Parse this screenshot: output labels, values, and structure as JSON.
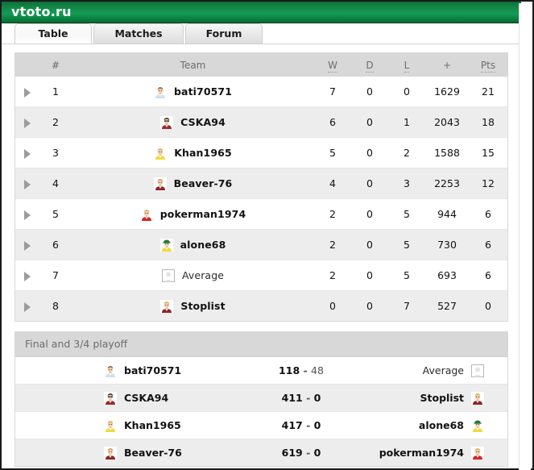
{
  "window": {
    "title": "vtoto.ru"
  },
  "tabs": [
    {
      "label": "Table",
      "active": true
    },
    {
      "label": "Matches",
      "active": false
    },
    {
      "label": "Forum",
      "active": false
    }
  ],
  "standings": {
    "columns": {
      "rank": "#",
      "team": "Team",
      "w": "W",
      "d": "D",
      "l": "L",
      "plus": "+",
      "pts": "Pts"
    },
    "rows": [
      {
        "rank": "1",
        "team": "bati70571",
        "avatar": "avatar-bati",
        "bold": true,
        "w": "7",
        "d": "0",
        "l": "0",
        "plus": "1629",
        "pts": "21"
      },
      {
        "rank": "2",
        "team": "CSKA94",
        "avatar": "avatar-cska",
        "bold": true,
        "w": "6",
        "d": "0",
        "l": "1",
        "plus": "2043",
        "pts": "18"
      },
      {
        "rank": "3",
        "team": "Khan1965",
        "avatar": "avatar-khan",
        "bold": true,
        "w": "5",
        "d": "0",
        "l": "2",
        "plus": "1588",
        "pts": "15"
      },
      {
        "rank": "4",
        "team": "Beaver-76",
        "avatar": "avatar-beaver",
        "bold": true,
        "w": "4",
        "d": "0",
        "l": "3",
        "plus": "2253",
        "pts": "12"
      },
      {
        "rank": "5",
        "team": "pokerman1974",
        "avatar": "avatar-pokerman",
        "bold": true,
        "w": "2",
        "d": "0",
        "l": "5",
        "plus": "944",
        "pts": "6"
      },
      {
        "rank": "6",
        "team": "alone68",
        "avatar": "avatar-alone",
        "bold": true,
        "w": "2",
        "d": "0",
        "l": "5",
        "plus": "730",
        "pts": "6"
      },
      {
        "rank": "7",
        "team": "Average",
        "avatar": "avatar-blank",
        "bold": false,
        "w": "2",
        "d": "0",
        "l": "5",
        "plus": "693",
        "pts": "6"
      },
      {
        "rank": "8",
        "team": "Stoplist",
        "avatar": "avatar-stoplist",
        "bold": true,
        "w": "0",
        "d": "0",
        "l": "7",
        "plus": "527",
        "pts": "0"
      }
    ]
  },
  "playoff": {
    "title": "Final and 3/4 playoff",
    "rows": [
      {
        "home": "bati70571",
        "home_avatar": "avatar-bati",
        "home_bold": true,
        "home_score": "118",
        "separator": "-",
        "away_score": "48",
        "away_score_dim": true,
        "away": "Average",
        "away_avatar": "avatar-blank",
        "away_bold": false
      },
      {
        "home": "CSKA94",
        "home_avatar": "avatar-cska",
        "home_bold": true,
        "home_score": "411",
        "separator": "-",
        "away_score": "0",
        "away_score_dim": false,
        "away": "Stoplist",
        "away_avatar": "avatar-stoplist",
        "away_bold": true
      },
      {
        "home": "Khan1965",
        "home_avatar": "avatar-khan",
        "home_bold": true,
        "home_score": "417",
        "separator": "-",
        "away_score": "0",
        "away_score_dim": false,
        "away": "alone68",
        "away_avatar": "avatar-alone",
        "away_bold": true
      },
      {
        "home": "Beaver-76",
        "home_avatar": "avatar-beaver",
        "home_bold": true,
        "home_score": "619",
        "separator": "-",
        "away_score": "0",
        "away_score_dim": false,
        "away": "pokerman1974",
        "away_avatar": "avatar-pokerman",
        "away_bold": true
      }
    ]
  },
  "colors": {
    "brand_green": "#13914e",
    "header_gray": "#d8d8d8",
    "row_alt": "#ededed",
    "text": "#121212",
    "muted": "#6d6d6d"
  },
  "icons": {
    "expand_arrow": "triangle-right"
  }
}
